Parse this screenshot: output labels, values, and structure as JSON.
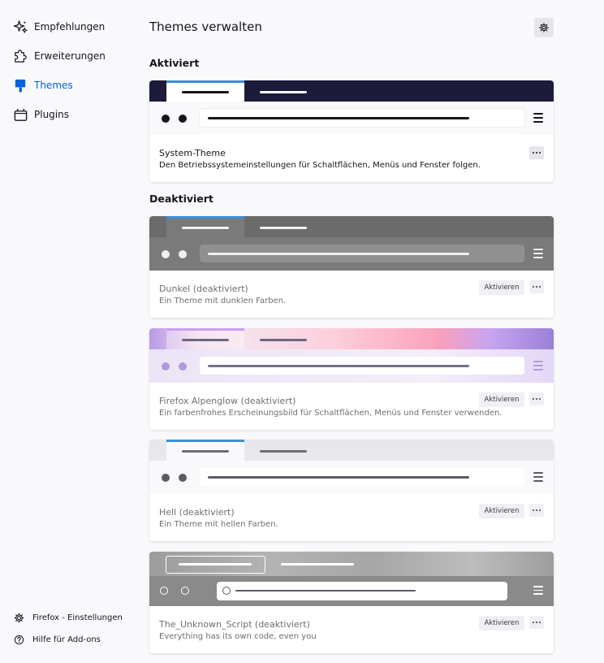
{
  "sidebar": {
    "items": [
      {
        "label": "Empfehlungen",
        "icon": "sparkle-icon"
      },
      {
        "label": "Erweiterungen",
        "icon": "puzzle-icon"
      },
      {
        "label": "Themes",
        "icon": "paintbrush-icon",
        "active": true
      },
      {
        "label": "Plugins",
        "icon": "plugin-icon"
      }
    ],
    "footer": [
      {
        "label": "Firefox - Einstellungen",
        "icon": "gear-icon"
      },
      {
        "label": "Hilfe für Add-ons",
        "icon": "help-icon"
      }
    ]
  },
  "main": {
    "title": "Themes verwalten",
    "settings_icon": "gear-icon",
    "sections": {
      "enabled": "Aktiviert",
      "disabled": "Deaktiviert"
    },
    "active_theme": {
      "name": "System-Theme",
      "description": "Den Betriebssystemeinstellungen für Schaltflächen, Menüs und Fenster folgen."
    },
    "themes": [
      {
        "name": "Dunkel (deaktiviert)",
        "description": "Ein Theme mit dunklen Farben.",
        "button": "Aktivieren"
      },
      {
        "name": "Firefox Alpenglow (deaktiviert)",
        "description": "Ein farbenfrohes Erscheinungsbild für Schaltflächen, Menüs und Fenster verwenden.",
        "button": "Aktivieren"
      },
      {
        "name": "Hell (deaktiviert)",
        "description": "Ein Theme mit hellen Farben.",
        "button": "Aktivieren"
      },
      {
        "name": "The_Unknown_Script (deaktiviert)",
        "description": "Everything has its own code, even you",
        "button": "Aktivieren"
      }
    ]
  },
  "colors": {
    "accent": "#0061e0",
    "tab_highlight": "#3d8fd8",
    "system_tabbar": "#1c1b3a",
    "dark_tabbar": "#6b6b6b",
    "dark_toolbar": "#7a7a7a",
    "light_tabbar": "#e8e8ec",
    "light_toolbar": "#f9f9fb"
  }
}
